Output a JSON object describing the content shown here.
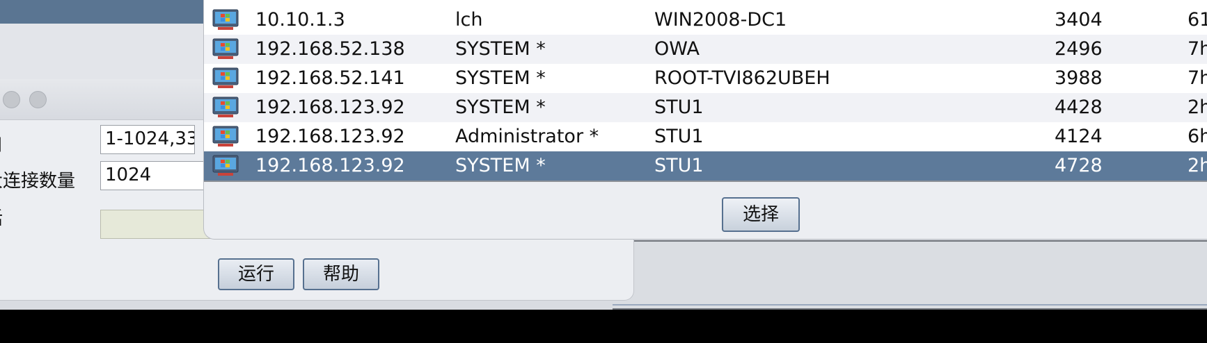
{
  "scan_dialog": {
    "fields": [
      {
        "label": "口",
        "value": "1-1024,33"
      },
      {
        "label": "大连接数量",
        "value": "1024"
      },
      {
        "label": "话",
        "value": ""
      }
    ],
    "buttons": {
      "run": "运行",
      "help": "帮助"
    }
  },
  "session_picker": {
    "rows": [
      {
        "address": "10.10.1.3",
        "user": "lch",
        "computer": "WIN2008-DC1",
        "pid": "3404",
        "last": "61",
        "selected": false
      },
      {
        "address": "192.168.52.138",
        "user": "SYSTEM *",
        "computer": "OWA",
        "pid": "2496",
        "last": "7h",
        "selected": false
      },
      {
        "address": "192.168.52.141",
        "user": "SYSTEM *",
        "computer": "ROOT-TVI862UBEH",
        "pid": "3988",
        "last": "7h",
        "selected": false
      },
      {
        "address": "192.168.123.92",
        "user": "SYSTEM *",
        "computer": "STU1",
        "pid": "4428",
        "last": "2h",
        "selected": false
      },
      {
        "address": "192.168.123.92",
        "user": "Administrator *",
        "computer": "STU1",
        "pid": "4124",
        "last": "6h",
        "selected": false
      },
      {
        "address": "192.168.123.92",
        "user": "SYSTEM *",
        "computer": "STU1",
        "pid": "4728",
        "last": "2h",
        "selected": true
      }
    ],
    "choose_label": "选择"
  },
  "colors": {
    "selection": "#5d7a9a",
    "button_border": "#56708f",
    "title_strip": "#5a7592"
  },
  "icons": {
    "row_icon": "windows-monitor-icon",
    "window_controls": "traffic-light-icon"
  }
}
